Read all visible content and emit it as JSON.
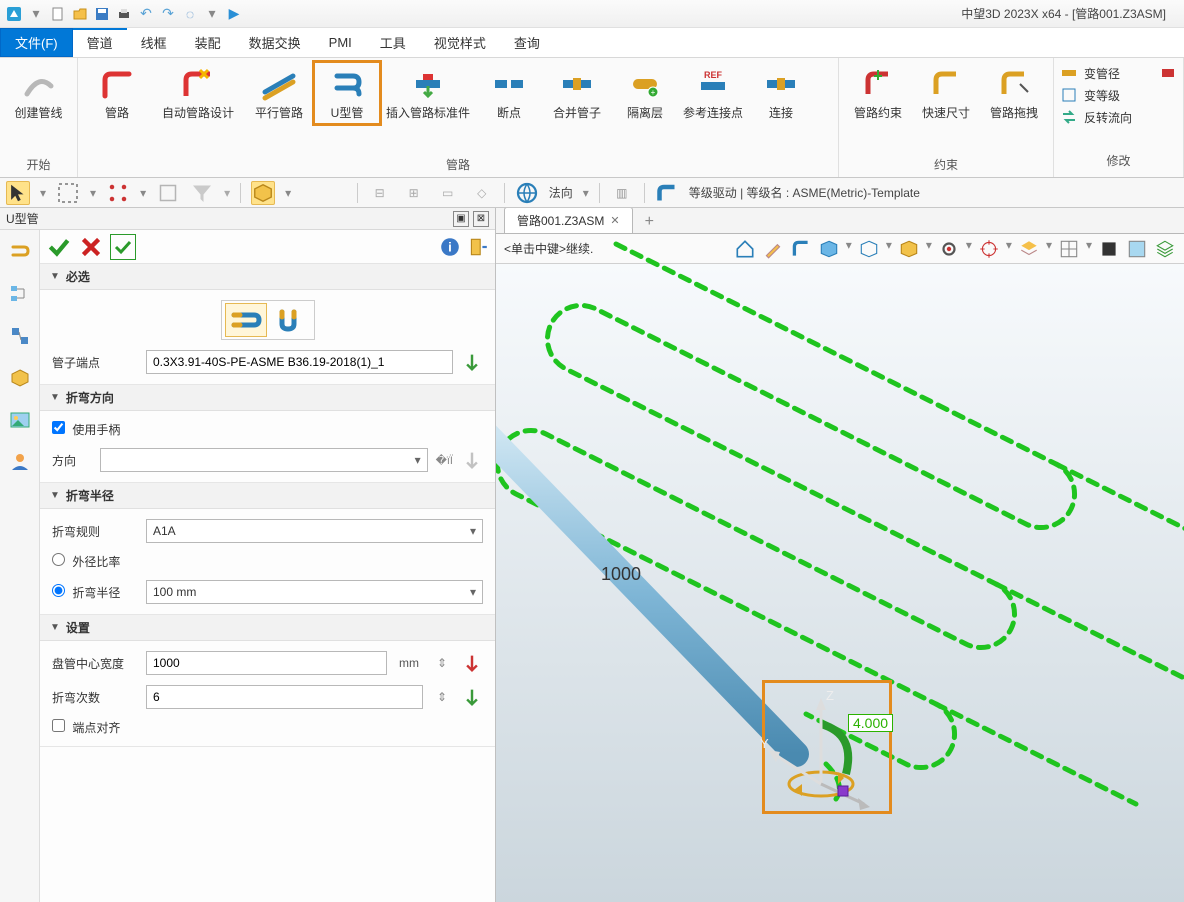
{
  "app": {
    "title": "中望3D 2023X x64 - [管路001.Z3ASM]"
  },
  "menu": {
    "file": "文件(F)",
    "tabs": [
      "管道",
      "线框",
      "装配",
      "数据交换",
      "PMI",
      "工具",
      "视觉样式",
      "查询"
    ],
    "active": "管道"
  },
  "ribbon": {
    "groups": [
      {
        "title": "开始",
        "buttons": [
          {
            "id": "create-pipeline",
            "label": "创建管线"
          }
        ]
      },
      {
        "title": "管路",
        "buttons": [
          {
            "id": "pipeline",
            "label": "管路"
          },
          {
            "id": "auto-design",
            "label": "自动管路设计"
          },
          {
            "id": "parallel",
            "label": "平行管路"
          },
          {
            "id": "u-tube",
            "label": "U型管",
            "highlight": true
          },
          {
            "id": "insert-std",
            "label": "插入管路标准件"
          },
          {
            "id": "break",
            "label": "断点"
          },
          {
            "id": "merge-tube",
            "label": "合并管子"
          },
          {
            "id": "isolate",
            "label": "隔离层"
          },
          {
            "id": "ref-connect",
            "label": "参考连接点"
          },
          {
            "id": "connect",
            "label": "连接"
          }
        ]
      },
      {
        "title": "约束",
        "buttons": [
          {
            "id": "route-constraint",
            "label": "管路约束"
          },
          {
            "id": "quick-dim",
            "label": "快速尺寸"
          },
          {
            "id": "route-drag",
            "label": "管路拖拽"
          }
        ]
      },
      {
        "title": "修改",
        "side": [
          {
            "id": "change-diameter",
            "label": "变管径"
          },
          {
            "id": "change-class",
            "label": "变等级"
          },
          {
            "id": "flip-flow",
            "label": "反转流向"
          }
        ]
      }
    ]
  },
  "quickbar": {
    "driver_text": "等级驱动 | 等级名 : ASME(Metric)-Template",
    "normal_label": "法向"
  },
  "panel": {
    "title": "U型管",
    "sections": {
      "required": {
        "title": "必选",
        "endpoint_label": "管子端点",
        "endpoint_value": "0.3X3.91-40S-PE-ASME B36.19-2018(1)_1"
      },
      "bend_dir": {
        "title": "折弯方向",
        "use_handle_label": "使用手柄",
        "use_handle_checked": true,
        "direction_label": "方向",
        "direction_value": ""
      },
      "bend_radius": {
        "title": "折弯半径",
        "rule_label": "折弯规则",
        "rule_value": "A1A",
        "ratio_label": "外径比率",
        "radius_label": "折弯半径",
        "radius_value": "100 mm",
        "radius_selected": true
      },
      "settings": {
        "title": "设置",
        "coil_width_label": "盘管中心宽度",
        "coil_width_value": "1000",
        "coil_width_unit": "mm",
        "bend_count_label": "折弯次数",
        "bend_count_value": "6",
        "align_label": "端点对齐",
        "align_checked": false
      }
    }
  },
  "canvas": {
    "tab_label": "管路001.Z3ASM",
    "hint": "<单击中键>继续.",
    "dim_main": "1000",
    "dim_green": "4.000"
  }
}
